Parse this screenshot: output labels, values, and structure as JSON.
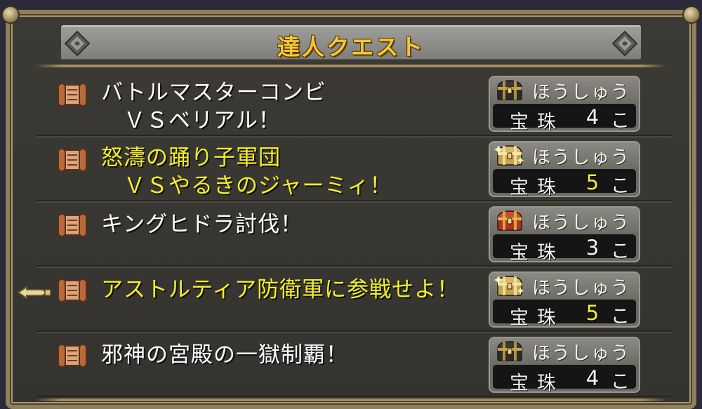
{
  "window": {
    "title": "達人クエスト"
  },
  "colors": {
    "accent_yellow": "#f5ee2a",
    "title_gold": "#f3c735",
    "frame_gold": "#8f7f5a"
  },
  "quests": [
    {
      "line1": "バトルマスターコンビ",
      "line2": "ＶＳベリアル！",
      "highlight": false,
      "reward": {
        "label": "ほうしゅう",
        "item": "宝珠",
        "count": "4",
        "unit": "こ",
        "chest": "dark-chest-icon",
        "count_highlight": false
      }
    },
    {
      "line1": "怒濤の踊り子軍団",
      "line2": "ＶＳやるきのジャーミィ！",
      "highlight": true,
      "reward": {
        "label": "ほうしゅう",
        "item": "宝珠",
        "count": "5",
        "unit": "こ",
        "chest": "gold-chest-icon",
        "count_highlight": true
      }
    },
    {
      "line1": "キングヒドラ討伐！",
      "line2": "",
      "highlight": false,
      "reward": {
        "label": "ほうしゅう",
        "item": "宝珠",
        "count": "3",
        "unit": "こ",
        "chest": "red-chest-icon",
        "count_highlight": false
      }
    },
    {
      "line1": "アストルティア防衛軍に参戦せよ！",
      "line2": "",
      "highlight": true,
      "reward": {
        "label": "ほうしゅう",
        "item": "宝珠",
        "count": "5",
        "unit": "こ",
        "chest": "gold-chest-icon",
        "count_highlight": true
      }
    },
    {
      "line1": "邪神の宮殿の一獄制覇！",
      "line2": "",
      "highlight": false,
      "reward": {
        "label": "ほうしゅう",
        "item": "宝珠",
        "count": "4",
        "unit": "こ",
        "chest": "dark-chest-icon",
        "count_highlight": false
      }
    }
  ],
  "cursor": {
    "icon": "pointing-hand-cursor-icon",
    "selected_index": 3
  }
}
